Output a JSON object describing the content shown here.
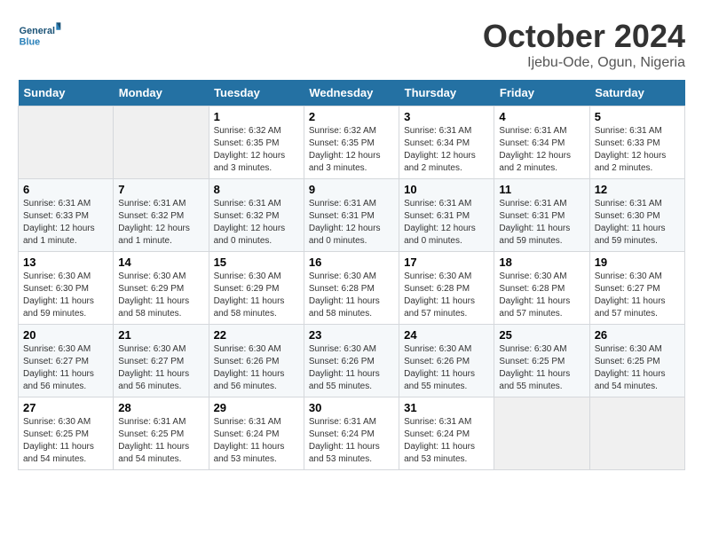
{
  "header": {
    "month_title": "October 2024",
    "location": "Ijebu-Ode, Ogun, Nigeria"
  },
  "logo": {
    "general": "General",
    "blue": "Blue"
  },
  "days_of_week": [
    "Sunday",
    "Monday",
    "Tuesday",
    "Wednesday",
    "Thursday",
    "Friday",
    "Saturday"
  ],
  "weeks": [
    [
      {
        "day": "",
        "sunrise": "",
        "sunset": "",
        "daylight": ""
      },
      {
        "day": "",
        "sunrise": "",
        "sunset": "",
        "daylight": ""
      },
      {
        "day": "1",
        "sunrise": "Sunrise: 6:32 AM",
        "sunset": "Sunset: 6:35 PM",
        "daylight": "Daylight: 12 hours and 3 minutes."
      },
      {
        "day": "2",
        "sunrise": "Sunrise: 6:32 AM",
        "sunset": "Sunset: 6:35 PM",
        "daylight": "Daylight: 12 hours and 3 minutes."
      },
      {
        "day": "3",
        "sunrise": "Sunrise: 6:31 AM",
        "sunset": "Sunset: 6:34 PM",
        "daylight": "Daylight: 12 hours and 2 minutes."
      },
      {
        "day": "4",
        "sunrise": "Sunrise: 6:31 AM",
        "sunset": "Sunset: 6:34 PM",
        "daylight": "Daylight: 12 hours and 2 minutes."
      },
      {
        "day": "5",
        "sunrise": "Sunrise: 6:31 AM",
        "sunset": "Sunset: 6:33 PM",
        "daylight": "Daylight: 12 hours and 2 minutes."
      }
    ],
    [
      {
        "day": "6",
        "sunrise": "Sunrise: 6:31 AM",
        "sunset": "Sunset: 6:33 PM",
        "daylight": "Daylight: 12 hours and 1 minute."
      },
      {
        "day": "7",
        "sunrise": "Sunrise: 6:31 AM",
        "sunset": "Sunset: 6:32 PM",
        "daylight": "Daylight: 12 hours and 1 minute."
      },
      {
        "day": "8",
        "sunrise": "Sunrise: 6:31 AM",
        "sunset": "Sunset: 6:32 PM",
        "daylight": "Daylight: 12 hours and 0 minutes."
      },
      {
        "day": "9",
        "sunrise": "Sunrise: 6:31 AM",
        "sunset": "Sunset: 6:31 PM",
        "daylight": "Daylight: 12 hours and 0 minutes."
      },
      {
        "day": "10",
        "sunrise": "Sunrise: 6:31 AM",
        "sunset": "Sunset: 6:31 PM",
        "daylight": "Daylight: 12 hours and 0 minutes."
      },
      {
        "day": "11",
        "sunrise": "Sunrise: 6:31 AM",
        "sunset": "Sunset: 6:31 PM",
        "daylight": "Daylight: 11 hours and 59 minutes."
      },
      {
        "day": "12",
        "sunrise": "Sunrise: 6:31 AM",
        "sunset": "Sunset: 6:30 PM",
        "daylight": "Daylight: 11 hours and 59 minutes."
      }
    ],
    [
      {
        "day": "13",
        "sunrise": "Sunrise: 6:30 AM",
        "sunset": "Sunset: 6:30 PM",
        "daylight": "Daylight: 11 hours and 59 minutes."
      },
      {
        "day": "14",
        "sunrise": "Sunrise: 6:30 AM",
        "sunset": "Sunset: 6:29 PM",
        "daylight": "Daylight: 11 hours and 58 minutes."
      },
      {
        "day": "15",
        "sunrise": "Sunrise: 6:30 AM",
        "sunset": "Sunset: 6:29 PM",
        "daylight": "Daylight: 11 hours and 58 minutes."
      },
      {
        "day": "16",
        "sunrise": "Sunrise: 6:30 AM",
        "sunset": "Sunset: 6:28 PM",
        "daylight": "Daylight: 11 hours and 58 minutes."
      },
      {
        "day": "17",
        "sunrise": "Sunrise: 6:30 AM",
        "sunset": "Sunset: 6:28 PM",
        "daylight": "Daylight: 11 hours and 57 minutes."
      },
      {
        "day": "18",
        "sunrise": "Sunrise: 6:30 AM",
        "sunset": "Sunset: 6:28 PM",
        "daylight": "Daylight: 11 hours and 57 minutes."
      },
      {
        "day": "19",
        "sunrise": "Sunrise: 6:30 AM",
        "sunset": "Sunset: 6:27 PM",
        "daylight": "Daylight: 11 hours and 57 minutes."
      }
    ],
    [
      {
        "day": "20",
        "sunrise": "Sunrise: 6:30 AM",
        "sunset": "Sunset: 6:27 PM",
        "daylight": "Daylight: 11 hours and 56 minutes."
      },
      {
        "day": "21",
        "sunrise": "Sunrise: 6:30 AM",
        "sunset": "Sunset: 6:27 PM",
        "daylight": "Daylight: 11 hours and 56 minutes."
      },
      {
        "day": "22",
        "sunrise": "Sunrise: 6:30 AM",
        "sunset": "Sunset: 6:26 PM",
        "daylight": "Daylight: 11 hours and 56 minutes."
      },
      {
        "day": "23",
        "sunrise": "Sunrise: 6:30 AM",
        "sunset": "Sunset: 6:26 PM",
        "daylight": "Daylight: 11 hours and 55 minutes."
      },
      {
        "day": "24",
        "sunrise": "Sunrise: 6:30 AM",
        "sunset": "Sunset: 6:26 PM",
        "daylight": "Daylight: 11 hours and 55 minutes."
      },
      {
        "day": "25",
        "sunrise": "Sunrise: 6:30 AM",
        "sunset": "Sunset: 6:25 PM",
        "daylight": "Daylight: 11 hours and 55 minutes."
      },
      {
        "day": "26",
        "sunrise": "Sunrise: 6:30 AM",
        "sunset": "Sunset: 6:25 PM",
        "daylight": "Daylight: 11 hours and 54 minutes."
      }
    ],
    [
      {
        "day": "27",
        "sunrise": "Sunrise: 6:30 AM",
        "sunset": "Sunset: 6:25 PM",
        "daylight": "Daylight: 11 hours and 54 minutes."
      },
      {
        "day": "28",
        "sunrise": "Sunrise: 6:31 AM",
        "sunset": "Sunset: 6:25 PM",
        "daylight": "Daylight: 11 hours and 54 minutes."
      },
      {
        "day": "29",
        "sunrise": "Sunrise: 6:31 AM",
        "sunset": "Sunset: 6:24 PM",
        "daylight": "Daylight: 11 hours and 53 minutes."
      },
      {
        "day": "30",
        "sunrise": "Sunrise: 6:31 AM",
        "sunset": "Sunset: 6:24 PM",
        "daylight": "Daylight: 11 hours and 53 minutes."
      },
      {
        "day": "31",
        "sunrise": "Sunrise: 6:31 AM",
        "sunset": "Sunset: 6:24 PM",
        "daylight": "Daylight: 11 hours and 53 minutes."
      },
      {
        "day": "",
        "sunrise": "",
        "sunset": "",
        "daylight": ""
      },
      {
        "day": "",
        "sunrise": "",
        "sunset": "",
        "daylight": ""
      }
    ]
  ]
}
